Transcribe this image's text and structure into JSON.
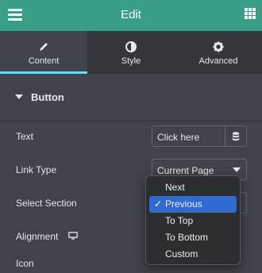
{
  "header": {
    "title": "Edit",
    "menu_icon": "hamburger-icon",
    "apps_icon": "grid-icon"
  },
  "tabs": [
    {
      "label": "Content",
      "icon": "pencil-icon",
      "active": true
    },
    {
      "label": "Style",
      "icon": "contrast-icon",
      "active": false
    },
    {
      "label": "Advanced",
      "icon": "gear-icon",
      "active": false
    }
  ],
  "section": {
    "title": "Button"
  },
  "fields": {
    "text": {
      "label": "Text",
      "value": "Click here"
    },
    "link_type": {
      "label": "Link Type",
      "value": "Current Page"
    },
    "select_section": {
      "label": "Select Section"
    },
    "alignment": {
      "label": "Alignment"
    },
    "icon": {
      "label": "Icon"
    }
  },
  "dropdown": {
    "options": [
      "Next",
      "Previous",
      "To Top",
      "To Bottom",
      "Custom"
    ],
    "selected": "Previous",
    "check_glyph": "✓"
  },
  "colors": {
    "header": "#3a9d88",
    "accent": "#71d7f7",
    "selection": "#2f6ad1",
    "panel": "#404349"
  }
}
